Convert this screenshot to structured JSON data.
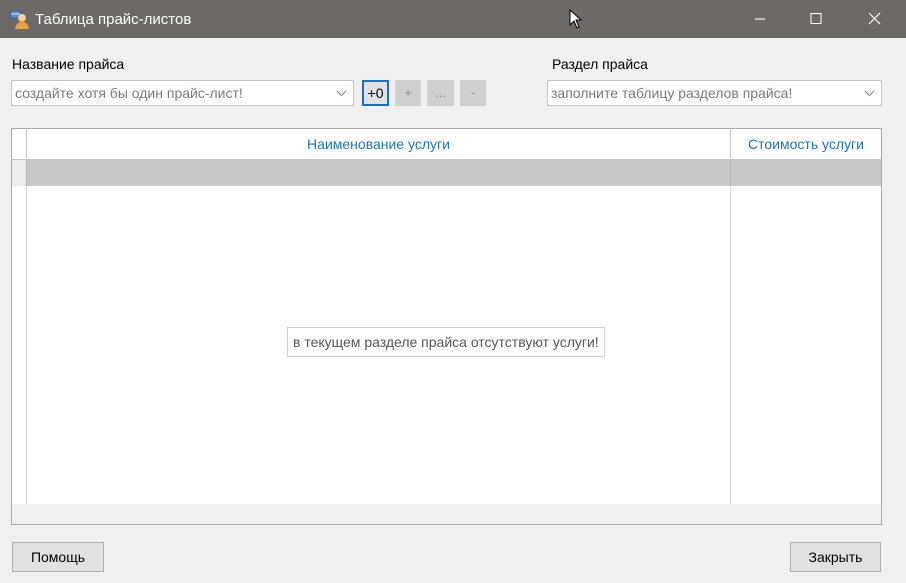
{
  "window": {
    "title": "Таблица прайс-листов",
    "app_icon": "user-table-icon",
    "controls": [
      "minimize-icon",
      "maximize-icon",
      "close-icon"
    ]
  },
  "price_name": {
    "label": "Название прайса",
    "value": "создайте хотя бы один прайс-лист!"
  },
  "buttons": {
    "add_zero": "+0",
    "add": "+",
    "edit": "...",
    "remove": "-"
  },
  "price_section": {
    "label": "Раздел прайса",
    "value": "заполните таблицу разделов прайса!"
  },
  "table": {
    "columns": [
      "Наименование услуги",
      "Стоимость услуги"
    ],
    "empty_message": "в текущем разделе прайса отсутствуют услуги!"
  },
  "footer": {
    "help": "Помощь",
    "close": "Закрыть"
  },
  "colors": {
    "titlebar": "#6d6968",
    "header_text": "#1e73be",
    "focus_border": "#1a6fc9"
  }
}
